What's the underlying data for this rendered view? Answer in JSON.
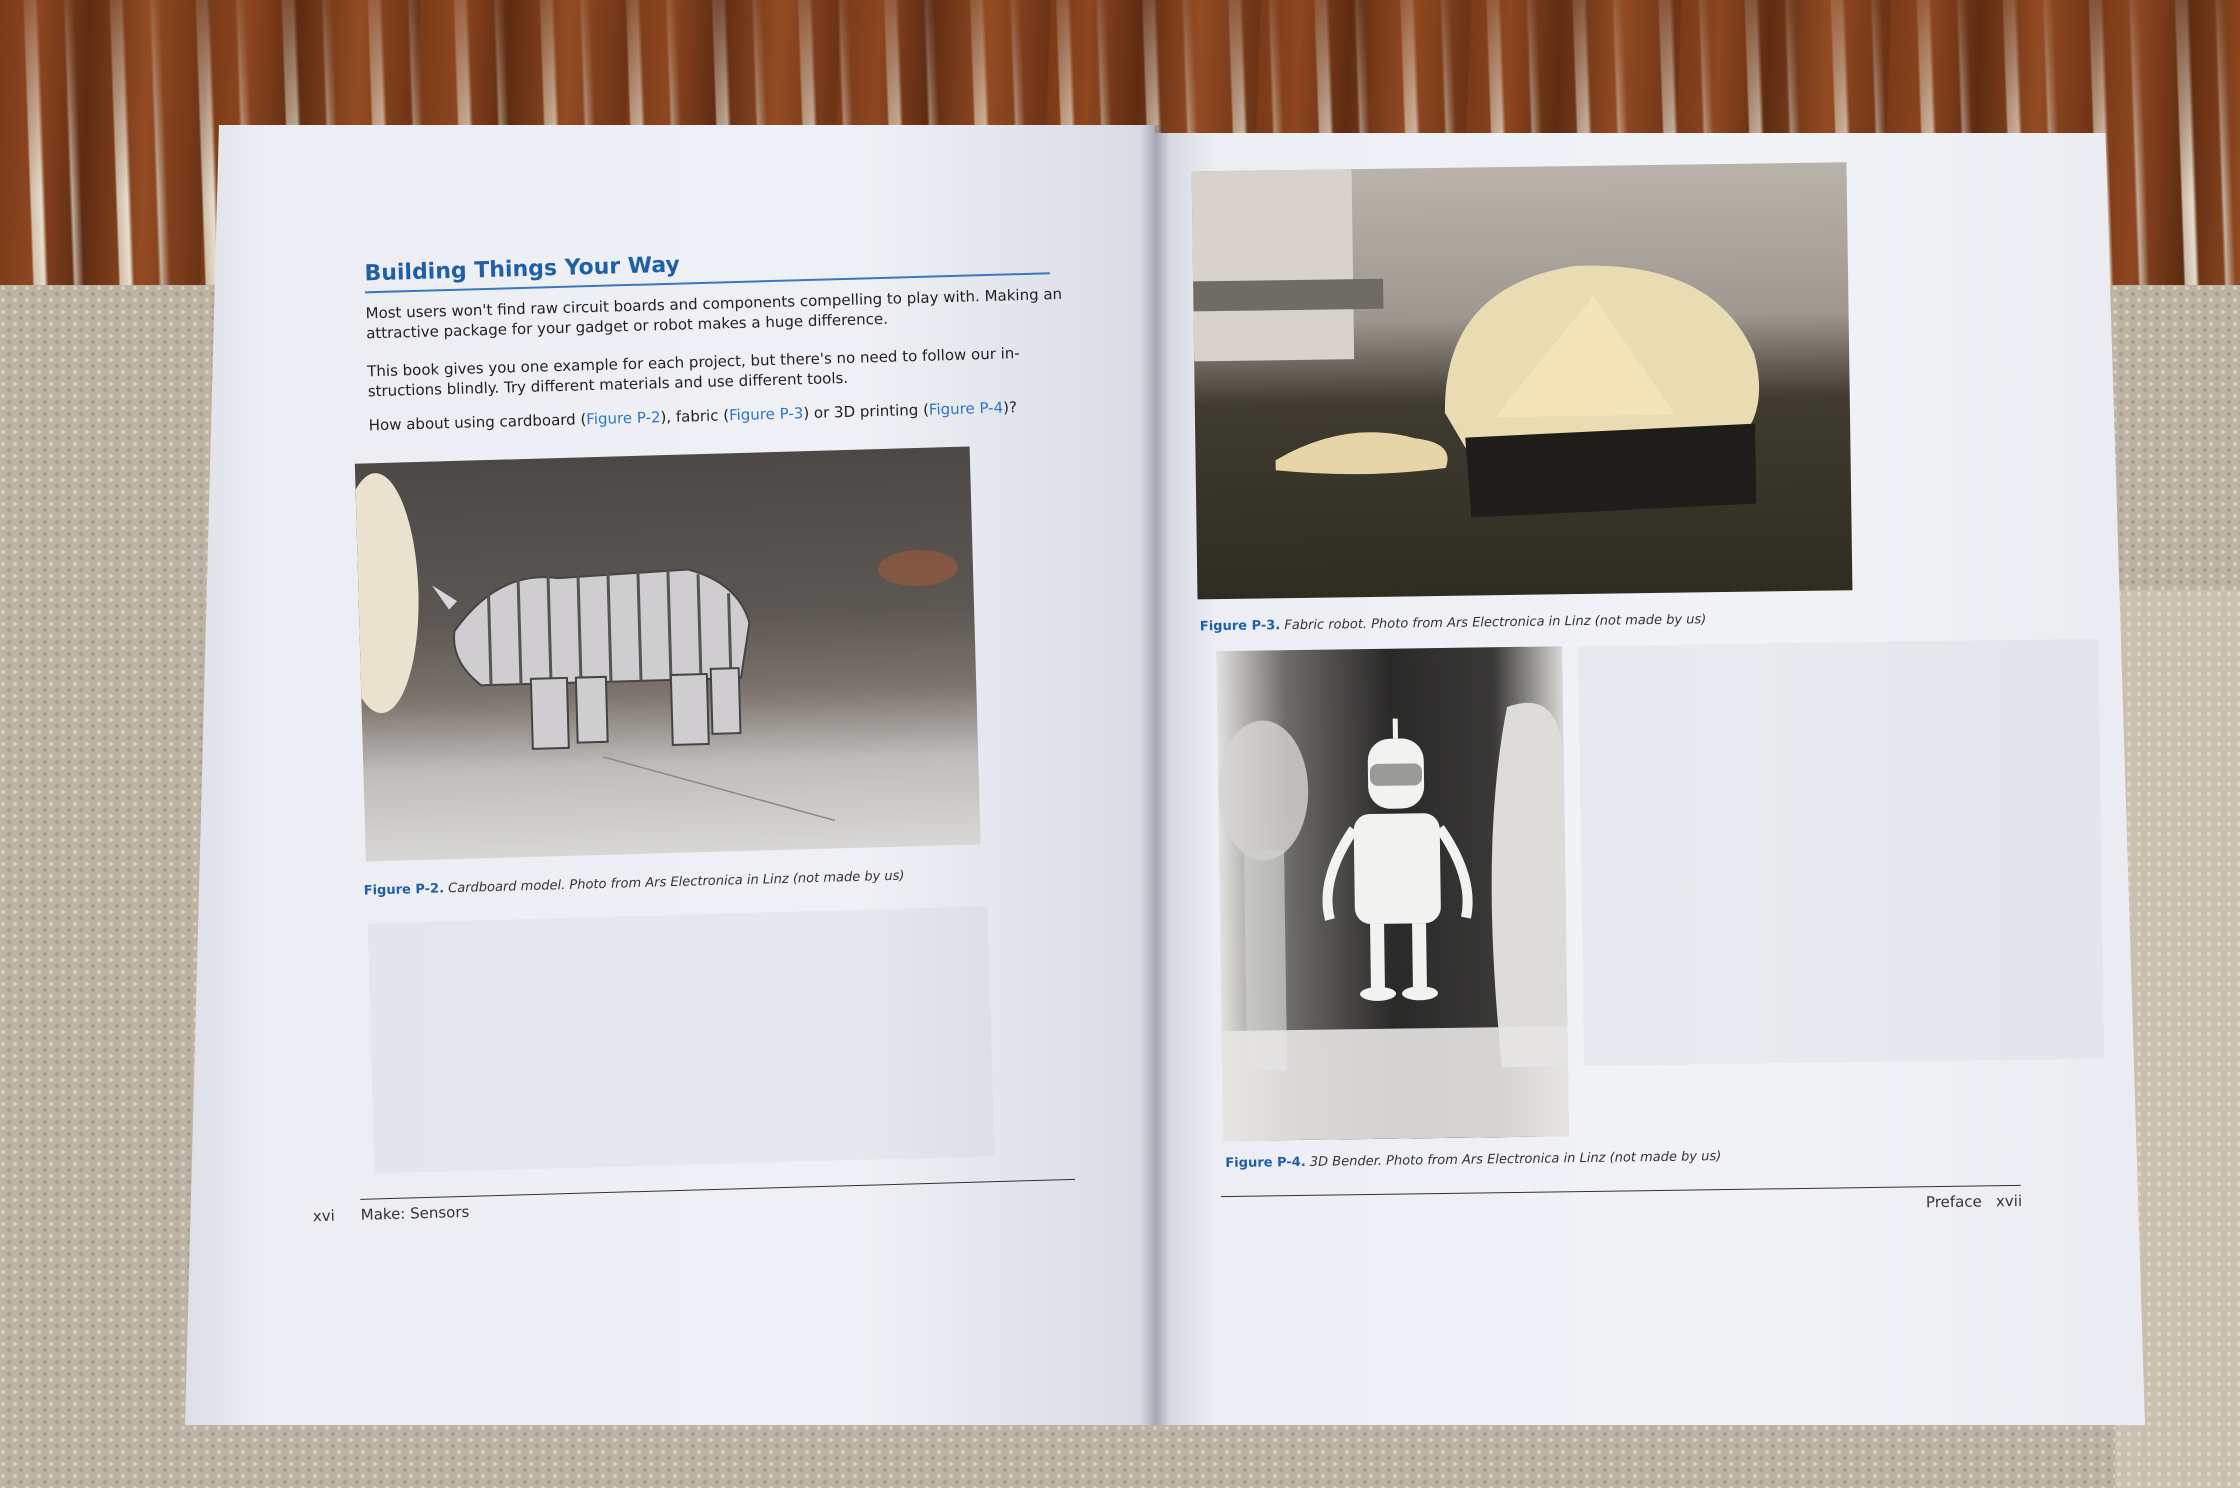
{
  "scene": {
    "description_colors": {
      "floor": "#6a3418",
      "rug": "#bdb3a4",
      "page": "#eef0f5",
      "accent_blue": "#1f5fa8"
    }
  },
  "left_page": {
    "section_title": "Building Things Your Way",
    "paragraphs": [
      "Most users won't find raw circuit boards and components compelling to play with. Making an attractive package for your gadget or robot makes a huge difference.",
      "This book gives you one example for each project, but there's no need to follow our in-structions blindly. Try different materials and use different tools."
    ],
    "question": {
      "prefix": "How about using cardboard (",
      "link1": "Figure P-2",
      "mid1": "), fabric (",
      "link2": "Figure P-3",
      "mid2": ") or 3D printing (",
      "link3": "Figure P-4",
      "suffix": ")?"
    },
    "figure_p2": {
      "label": "Figure P-2.",
      "caption": " Cardboard model. Photo from Ars Electronica in Linz (not made by us)"
    },
    "footer": {
      "folio": "xvi",
      "running_head": "Make: Sensors"
    }
  },
  "right_page": {
    "figure_p3": {
      "label": "Figure P-3.",
      "caption": " Fabric robot. Photo from Ars Electronica in Linz (not made by us)"
    },
    "figure_p4": {
      "label": "Figure P-4.",
      "caption": " 3D Bender. Photo from Ars Electronica in Linz (not made by us)"
    },
    "footer": {
      "running_head": "Preface",
      "folio": "xvii"
    }
  }
}
